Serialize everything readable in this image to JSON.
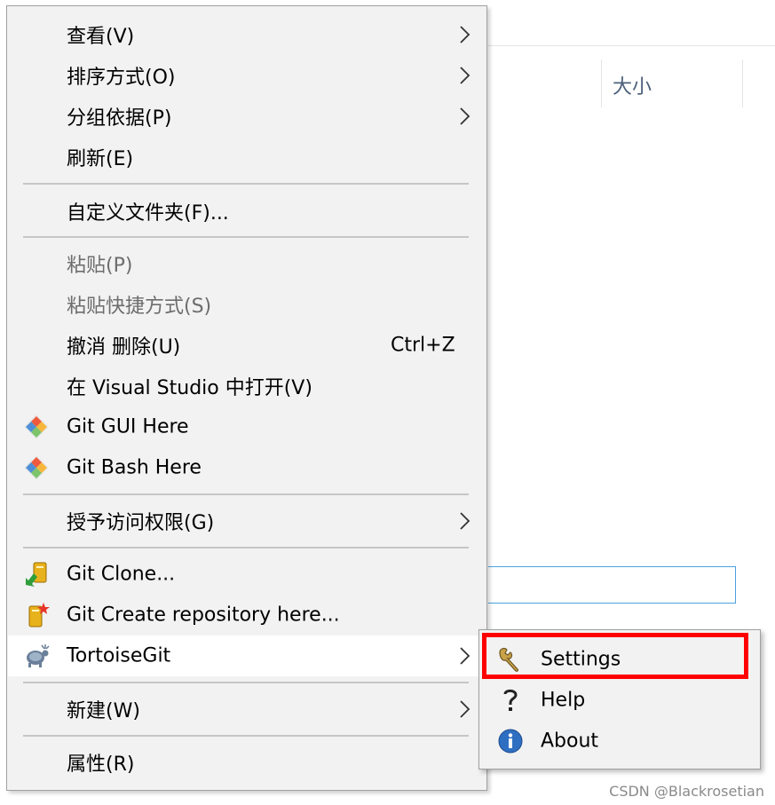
{
  "explorer": {
    "column_header": "大小"
  },
  "context_menu": {
    "view": {
      "label": "查看(V)"
    },
    "sort_by": {
      "label": "排序方式(O)"
    },
    "group_by": {
      "label": "分组依据(P)"
    },
    "refresh": {
      "label": "刷新(E)"
    },
    "customize_folder": {
      "label": "自定义文件夹(F)..."
    },
    "paste": {
      "label": "粘贴(P)"
    },
    "paste_shortcut": {
      "label": "粘贴快捷方式(S)"
    },
    "undo_delete": {
      "label": "撤消 删除(U)",
      "shortcut": "Ctrl+Z"
    },
    "open_in_vs": {
      "label": "在 Visual Studio 中打开(V)"
    },
    "git_gui": {
      "label": "Git GUI Here"
    },
    "git_bash": {
      "label": "Git Bash Here"
    },
    "give_access": {
      "label": "授予访问权限(G)"
    },
    "git_clone": {
      "label": "Git Clone..."
    },
    "git_create_repo": {
      "label": "Git Create repository here..."
    },
    "tortoisegit": {
      "label": "TortoiseGit"
    },
    "new": {
      "label": "新建(W)"
    },
    "properties": {
      "label": "属性(R)"
    }
  },
  "tortoisegit_submenu": {
    "settings": {
      "label": "Settings"
    },
    "help": {
      "label": "Help"
    },
    "about": {
      "label": "About"
    }
  },
  "watermark": {
    "text": "CSDN @Blackrosetian"
  },
  "colors": {
    "highlight_border": "#ff0000",
    "menu_bg": "#f2f2f2",
    "accent_blue": "#4aa3df"
  },
  "icons": {
    "git_gui": "git-diamond-icon",
    "git_bash": "git-diamond-icon",
    "git_clone": "git-clone-icon",
    "git_create_repo": "git-create-repo-icon",
    "tortoisegit": "tortoisegit-icon",
    "settings": "wrench-icon",
    "help": "help-icon",
    "about": "info-icon"
  }
}
